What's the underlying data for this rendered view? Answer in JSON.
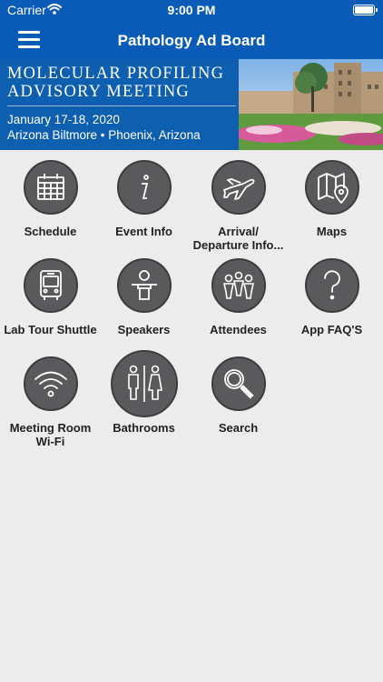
{
  "status_bar": {
    "carrier": "Carrier",
    "time": "9:00 PM"
  },
  "header": {
    "title": "Pathology Ad Board",
    "menu_icon": "hamburger-icon"
  },
  "banner": {
    "title_line1": "MOLECULAR PROFILING",
    "title_line2": "ADVISORY MEETING",
    "date": "January 17-18, 2020",
    "location": "Arizona Biltmore  •  Phoenix, Arizona"
  },
  "tiles": [
    {
      "label": "Schedule",
      "icon": "calendar-icon"
    },
    {
      "label": "Event Info",
      "icon": "info-icon"
    },
    {
      "label": "Arrival/",
      "label2": "Departure Info...",
      "icon": "airplane-icon"
    },
    {
      "label": "Maps",
      "icon": "map-icon"
    },
    {
      "label": "Lab Tour Shuttle",
      "icon": "bus-icon"
    },
    {
      "label": "Speakers",
      "icon": "speaker-podium-icon"
    },
    {
      "label": "Attendees",
      "icon": "people-icon"
    },
    {
      "label": "App FAQ'S",
      "icon": "question-icon"
    },
    {
      "label": "Meeting Room",
      "label2": "Wi-Fi",
      "icon": "wifi-icon"
    },
    {
      "label": "Bathrooms",
      "icon": "restroom-icon"
    },
    {
      "label": "Search",
      "icon": "search-icon"
    }
  ],
  "colors": {
    "header": "#0a5bb8",
    "banner": "#0f5fb0",
    "icon_circle": "#5a5a5d",
    "background": "#ececec"
  }
}
